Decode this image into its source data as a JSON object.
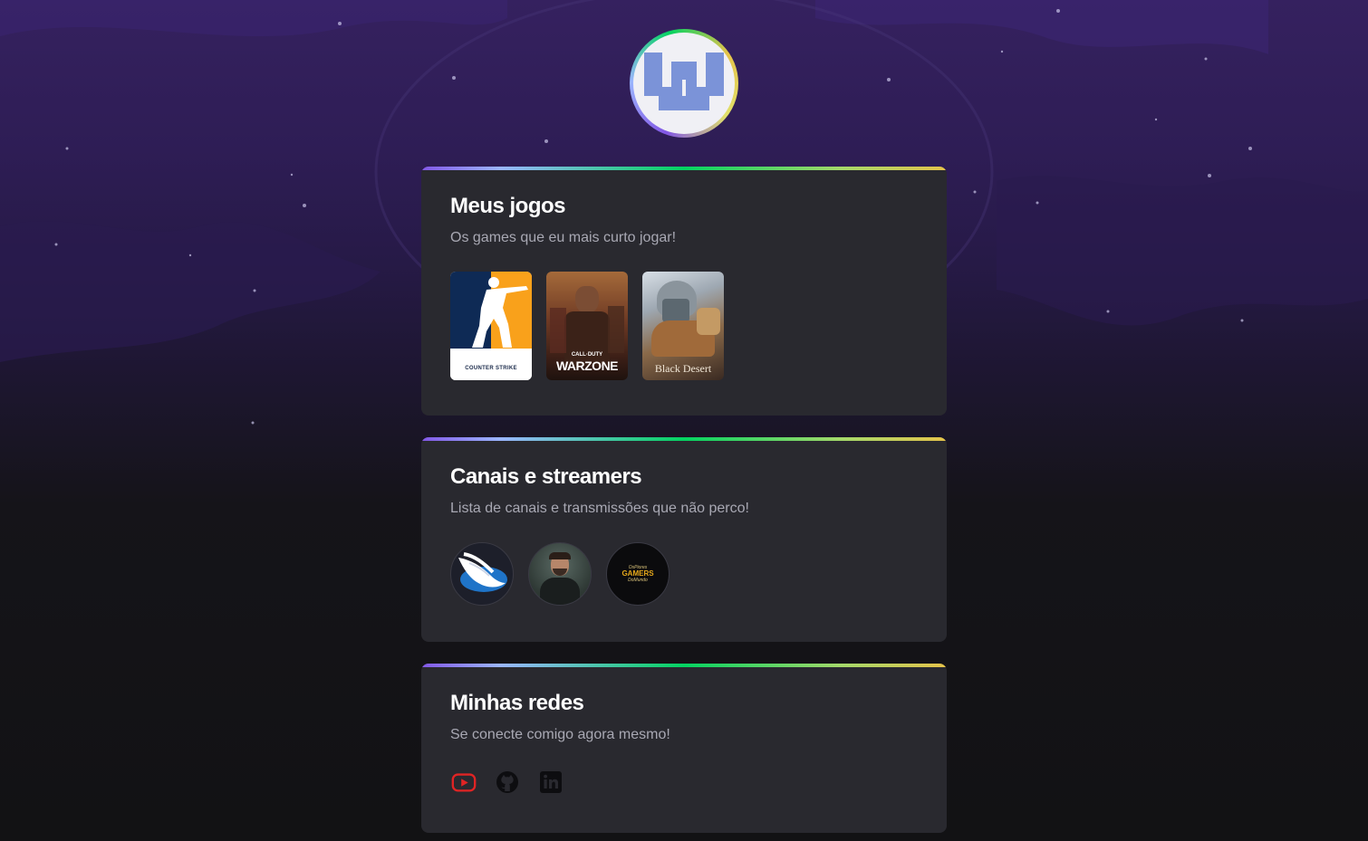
{
  "profile": {
    "avatar_alt": "Logo"
  },
  "games_section": {
    "title": "Meus jogos",
    "subtitle": "Os games que eu mais curto jogar!",
    "games": [
      {
        "name": "Counter-Strike",
        "caption": "COUNTER STRIKE"
      },
      {
        "name": "Call of Duty Warzone",
        "caption_top": "CALL·DUTY",
        "caption": "WARZONE"
      },
      {
        "name": "Black Desert",
        "caption": "Black Desert"
      }
    ]
  },
  "streamers_section": {
    "title": "Canais e streamers",
    "subtitle": "Lista de canais e transmissões que não perco!",
    "streamers": [
      {
        "name": "streamer-1"
      },
      {
        "name": "streamer-2"
      },
      {
        "name": "streamer-3",
        "caption_top": "OsPiores",
        "caption_mid": "GAMERS",
        "caption_bot": "DoMundo"
      }
    ]
  },
  "social_section": {
    "title": "Minhas redes",
    "subtitle": "Se conecte comigo agora mesmo!",
    "links": [
      {
        "icon": "youtube-icon"
      },
      {
        "icon": "github-icon"
      },
      {
        "icon": "linkedin-icon"
      }
    ]
  },
  "colors": {
    "card_bg": "#29292f",
    "page_bg": "#121214",
    "accent_gradient": [
      "#8257e5",
      "#04d361",
      "#e5c34a"
    ],
    "youtube_red": "#e02424"
  }
}
